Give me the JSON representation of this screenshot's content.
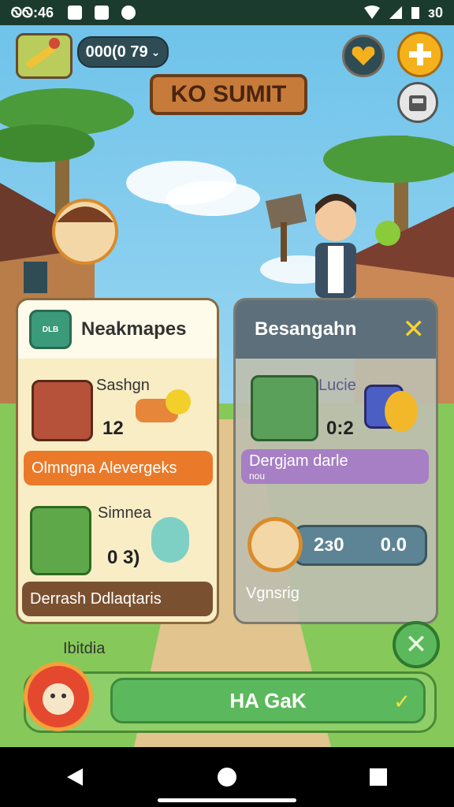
{
  "status_bar": {
    "time": "ᏫᏫ:46",
    "battery_text": "ᴈ0"
  },
  "top": {
    "currency_value": "000(0 79",
    "title": "KO SUMIT"
  },
  "left_card": {
    "title": "Neakmapes",
    "head_icon_text": "DLB",
    "item1": {
      "label": "Sashgn",
      "count": "12",
      "banner": "Olmngna Alevergeks",
      "banner_color": "#ea7a2a"
    },
    "item2": {
      "label": "Simnea",
      "count": "0 3)",
      "banner": "Derrash Ddlaqtaris",
      "banner_color": "#7a5130"
    }
  },
  "right_card": {
    "title": "Besangahn",
    "close_label": "✕",
    "item1": {
      "label": "Lucie",
      "count": "0:2",
      "banner": "Dergjam darle",
      "banner_sub": "nou",
      "banner_color": "#a77fc4"
    },
    "timer": {
      "left": "2ᴈ0",
      "right": "0.0"
    },
    "footer_text": "Vgnsrig"
  },
  "bottom": {
    "label": "Ibitdia",
    "go_button": "HA GaK",
    "check": "✓",
    "close": "✕"
  }
}
